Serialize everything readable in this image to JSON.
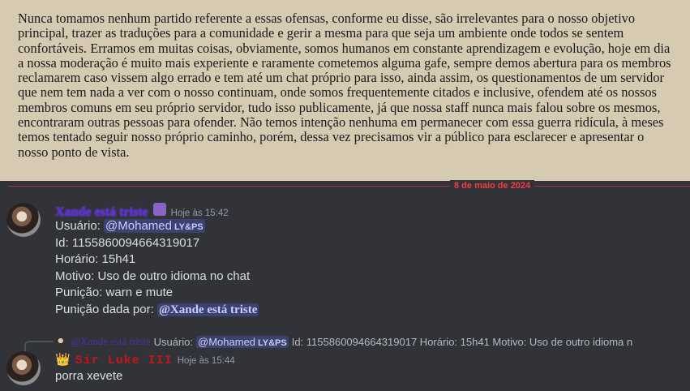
{
  "document": {
    "paragraph": "Nunca tomamos nenhum partido referente a essas ofensas, conforme eu disse, são irrelevantes para o nosso objetivo principal, trazer as traduções para a comunidade e gerir a mesma para que seja um ambiente onde todos se sentem confortáveis. Erramos em muitas coisas, obviamente, somos humanos em constante aprendizagem e evolução, hoje em dia a nossa moderação é muito mais experiente e raramente cometemos alguma gafe, sempre demos abertura para os membros reclamarem caso vissem algo errado e tem até um chat próprio para isso, ainda assim, os questionamentos de um servidor que nem tem nada a ver com o nosso continuam, onde somos frequentemente citados e inclusive, ofendem até os nossos membros comuns em seu próprio servidor, tudo isso publicamente, já que nossa staff nunca mais falou sobre os mesmos, encontraram outras pessoas para ofender. Não temos intenção nenhuma em permanecer com essa guerra ridícula, à meses temos tentado seguir nosso próprio caminho, porém, dessa vez precisamos vir a público para esclarecer e apresentar o nosso ponto de vista."
  },
  "date_divider": "8 de maio de 2024",
  "message1": {
    "username": "Xande está triste",
    "timestamp": "Hoje às 15:42",
    "line1_label": "Usuário: ",
    "line1_mention": "@Mohamed",
    "line1_tag": "LY&PS",
    "line2": "Id: 1155860094664319017",
    "line3": "Horário: 15h41",
    "line4": "Motivo: Uso de outro idioma no chat",
    "line5": "Punição: warn e mute",
    "line6_label": "Punição dada por: ",
    "line6_mention": "@Xande está triste"
  },
  "reply": {
    "username": "@Xande está triste",
    "label": "Usuário:",
    "mention": "@Mohamed",
    "tag": "LY&PS",
    "rest": "Id: 1155860094664319017 Horário: 15h41 Motivo: Uso de outro idioma n"
  },
  "message2": {
    "username": "Sir Luke III",
    "timestamp": "Hoje às 15:44",
    "text": "porra xevete"
  },
  "colors": {
    "document_bg": "#d6cab3",
    "chat_bg": "#313338",
    "divider": "#f23f43",
    "mention_bg": "#3c4270"
  }
}
